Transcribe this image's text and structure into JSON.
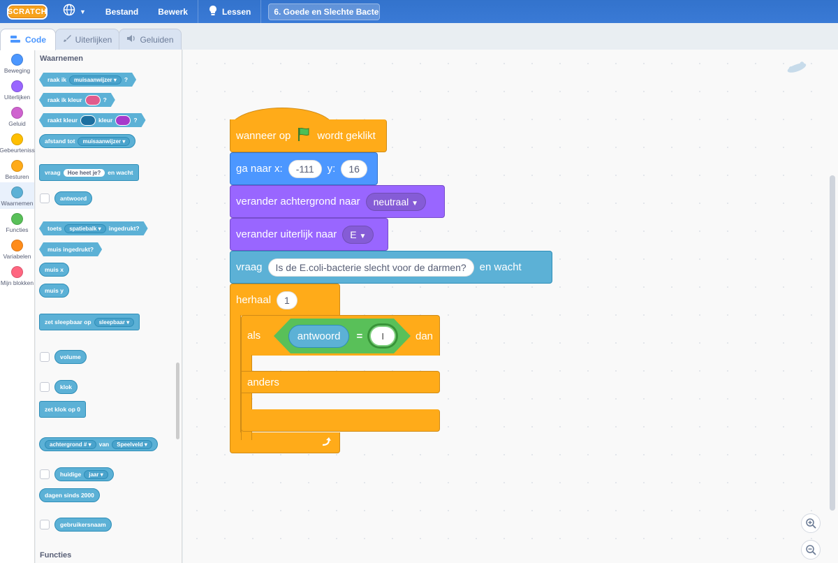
{
  "menubar": {
    "logo": "SCRATCH",
    "file": "Bestand",
    "edit": "Bewerk",
    "tutorials": "Lessen",
    "project_title": "6. Goede en Slechte Bacte..."
  },
  "tabs": [
    {
      "label": "Code",
      "active": true
    },
    {
      "label": "Uiterlijken",
      "active": false
    },
    {
      "label": "Geluiden",
      "active": false
    }
  ],
  "categories": [
    {
      "label": "Beweging",
      "color": "#4c97ff"
    },
    {
      "label": "Uiterlijken",
      "color": "#9966ff"
    },
    {
      "label": "Geluid",
      "color": "#cf63cf"
    },
    {
      "label": "Gebeurteniss",
      "color": "#ffbf00"
    },
    {
      "label": "Besturen",
      "color": "#ffab19"
    },
    {
      "label": "Waarnemen",
      "color": "#5cb1d6"
    },
    {
      "label": "Functies",
      "color": "#59c059"
    },
    {
      "label": "Variabelen",
      "color": "#ff8c1a"
    },
    {
      "label": "Mijn blokken",
      "color": "#ff6680"
    }
  ],
  "palette": {
    "section_title": "Waarnemen",
    "section_title_next": "Functies",
    "touching": {
      "label": "raak ik",
      "dropdown": "muisaanwijzer",
      "end": "?"
    },
    "touching_color": {
      "label": "raak ik kleur",
      "end": "?",
      "color": "#e05c8d"
    },
    "color_touching": {
      "label": "raakt kleur",
      "mid": "kleur",
      "end": "?",
      "color1": "#1c6fa0",
      "color2": "#a63acb"
    },
    "distance": {
      "label": "afstand tot",
      "dropdown": "muisaanwijzer"
    },
    "ask": {
      "label": "vraag",
      "input": "Hoe heet je?",
      "end": "en wacht"
    },
    "answer": "antwoord",
    "key_pressed": {
      "label": "toets",
      "dropdown": "spatiebalk",
      "end": "ingedrukt?"
    },
    "mouse_down": "muis ingedrukt?",
    "mouse_x": "muis x",
    "mouse_y": "muis y",
    "drag_mode": {
      "label": "zet sleepbaar op",
      "dropdown": "sleepbaar"
    },
    "loudness": "volume",
    "timer": "klok",
    "reset_timer": "zet klok op 0",
    "backdrop_of": {
      "dropdown": "achtergrond #",
      "mid": "van",
      "dropdown2": "Speelveld"
    },
    "current": {
      "label": "huidige",
      "dropdown": "jaar"
    },
    "days_since": "dagen sinds 2000",
    "username": "gebruikersnaam"
  },
  "script": {
    "hat": {
      "before": "wanneer op",
      "after": "wordt geklikt",
      "flag": "green-flag"
    },
    "goto": {
      "label": "ga naar x:",
      "x": "-111",
      "ylabel": "y:",
      "y": "16"
    },
    "switch_backdrop": {
      "label": "verander achtergrond naar",
      "value": "neutraal"
    },
    "switch_costume": {
      "label": "verander uiterlijk naar",
      "value": "E"
    },
    "ask": {
      "label": "vraag",
      "question": "Is de E.coli-bacterie slecht voor de darmen?",
      "end": "en wacht"
    },
    "repeat": {
      "label": "herhaal",
      "times": "1"
    },
    "if_else": {
      "if_label": "als",
      "then_label": "dan",
      "else_label": "anders"
    },
    "condition": {
      "left": "antwoord",
      "op": "=",
      "right": ""
    }
  },
  "zoom": {
    "in": "zoom-in",
    "out": "zoom-out"
  }
}
